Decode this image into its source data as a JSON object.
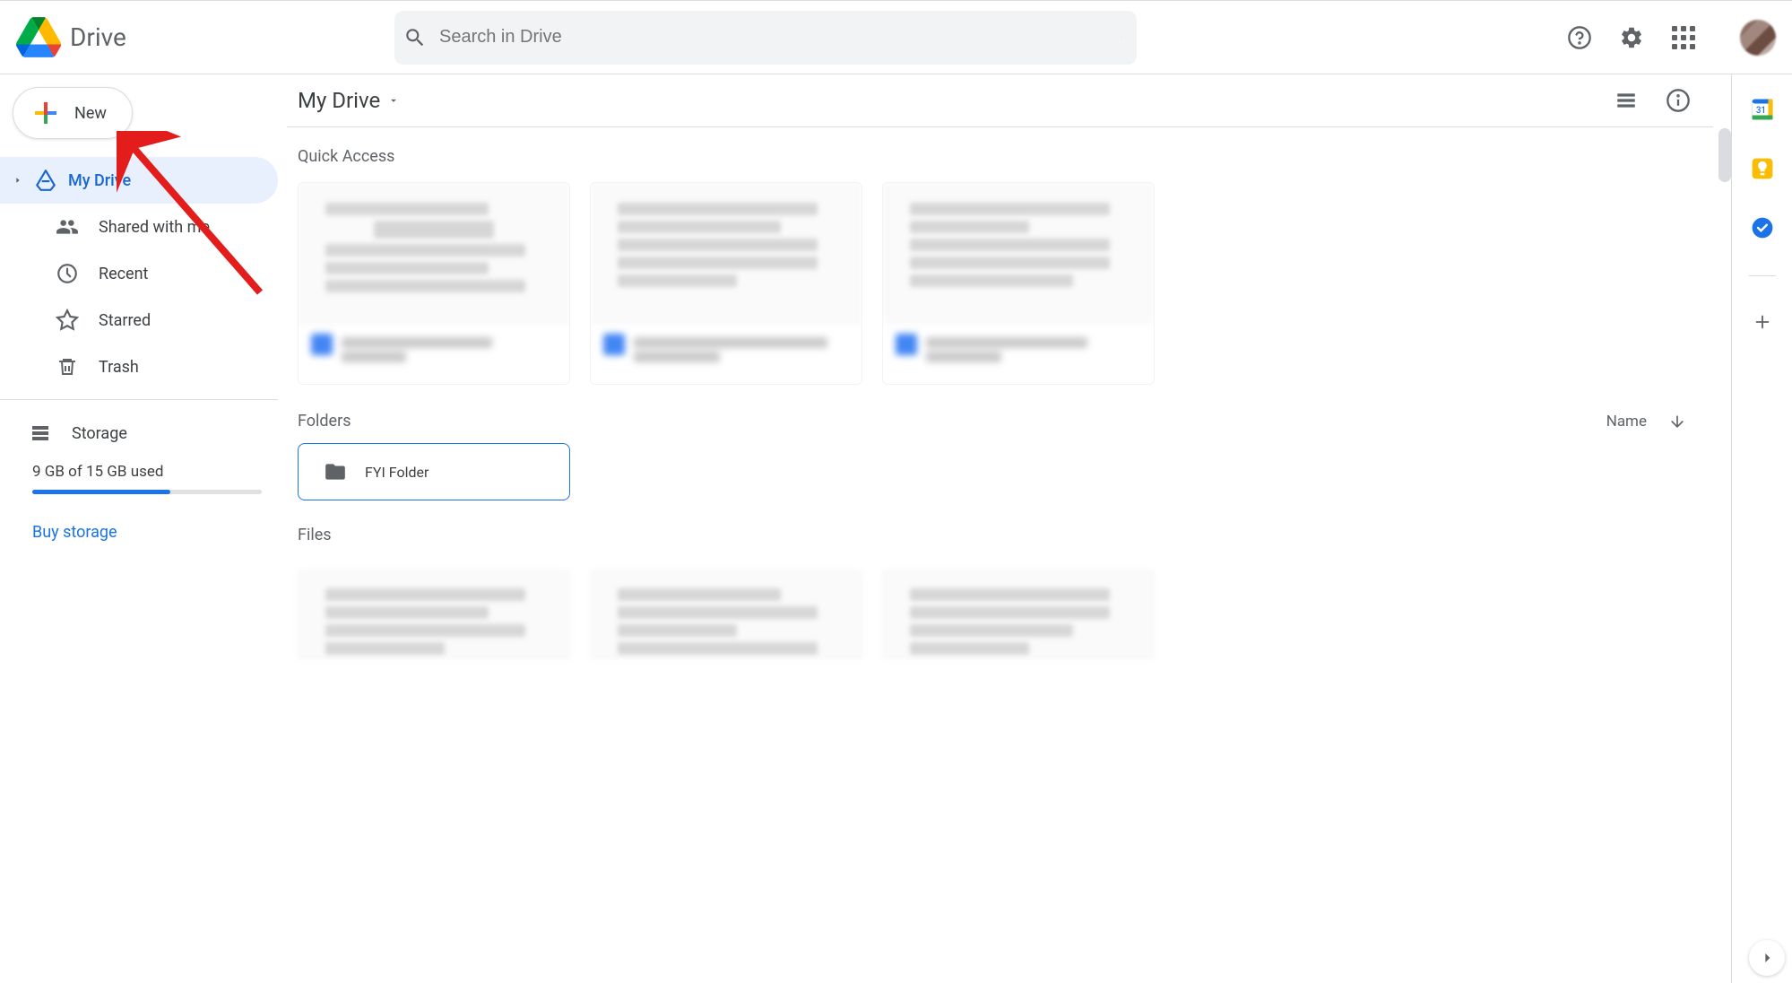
{
  "header": {
    "product_name": "Drive",
    "search_placeholder": "Search in Drive"
  },
  "sidebar": {
    "new_label": "New",
    "items": [
      {
        "label": "My Drive"
      },
      {
        "label": "Shared with me"
      },
      {
        "label": "Recent"
      },
      {
        "label": "Starred"
      },
      {
        "label": "Trash"
      }
    ],
    "storage": {
      "title": "Storage",
      "usage_text": "9 GB of 15 GB used",
      "buy_label": "Buy storage",
      "fill_percent": 60
    }
  },
  "main": {
    "breadcrumb": "My Drive",
    "quick_access_title": "Quick Access",
    "folders_title": "Folders",
    "sort_label": "Name",
    "folders": [
      {
        "name": "FYI Folder"
      }
    ],
    "files_title": "Files"
  },
  "right_rail": {
    "calendar_day": "31"
  }
}
